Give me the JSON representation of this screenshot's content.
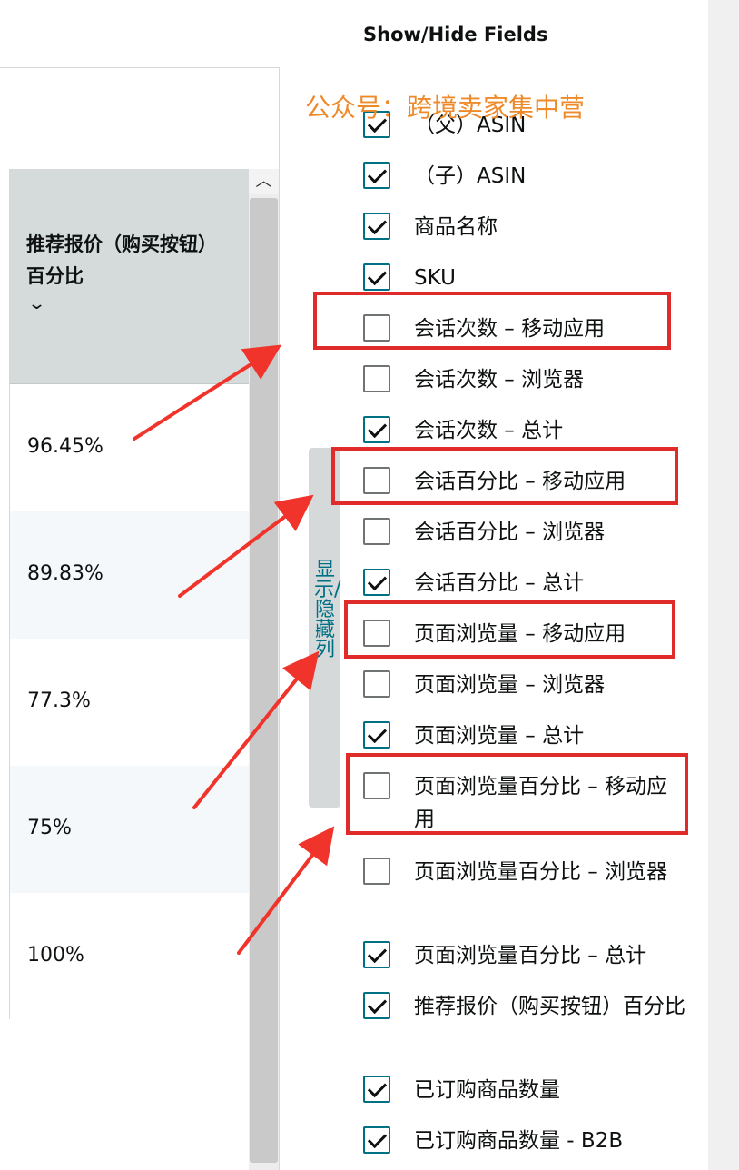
{
  "table": {
    "column_header": "推荐报价（购买按钮）百分比",
    "sort_icon": "chevron-down-icon",
    "scroll_icon": "chevron-up-icon",
    "rows": [
      "96.45%",
      "89.83%",
      "77.3%",
      "75%",
      "100%"
    ]
  },
  "toggle_tab": {
    "label": "显示/隐藏列"
  },
  "panel": {
    "title": "Show/Hide Fields",
    "watermark": "公众号：跨境卖家集中营",
    "fields": [
      {
        "label": "（父）ASIN",
        "checked": true
      },
      {
        "label": "（子）ASIN",
        "checked": true
      },
      {
        "label": "商品名称",
        "checked": true
      },
      {
        "label": "SKU",
        "checked": true
      },
      {
        "label": "会话次数 – 移动应用",
        "checked": false
      },
      {
        "label": "会话次数 – 浏览器",
        "checked": false
      },
      {
        "label": "会话次数 – 总计",
        "checked": true
      },
      {
        "label": "会话百分比 – 移动应用",
        "checked": false
      },
      {
        "label": "会话百分比 – 浏览器",
        "checked": false
      },
      {
        "label": "会话百分比 – 总计",
        "checked": true
      },
      {
        "label": "页面浏览量 – 移动应用",
        "checked": false
      },
      {
        "label": "页面浏览量 – 浏览器",
        "checked": false
      },
      {
        "label": "页面浏览量 – 总计",
        "checked": true
      },
      {
        "label": "页面浏览量百分比 – 移动应用",
        "checked": false
      },
      {
        "label": "页面浏览量百分比 – 浏览器",
        "checked": false
      },
      {
        "label": "页面浏览量百分比 – 总计",
        "checked": true
      },
      {
        "label": "推荐报价（购买按钮）百分比",
        "checked": true
      },
      {
        "label": "已订购商品数量",
        "checked": true
      },
      {
        "label": "已订购商品数量 - B2B",
        "checked": true
      }
    ]
  },
  "annotations": {
    "highlight_color": "#e02b2b",
    "arrow_color": "#f0342c"
  }
}
